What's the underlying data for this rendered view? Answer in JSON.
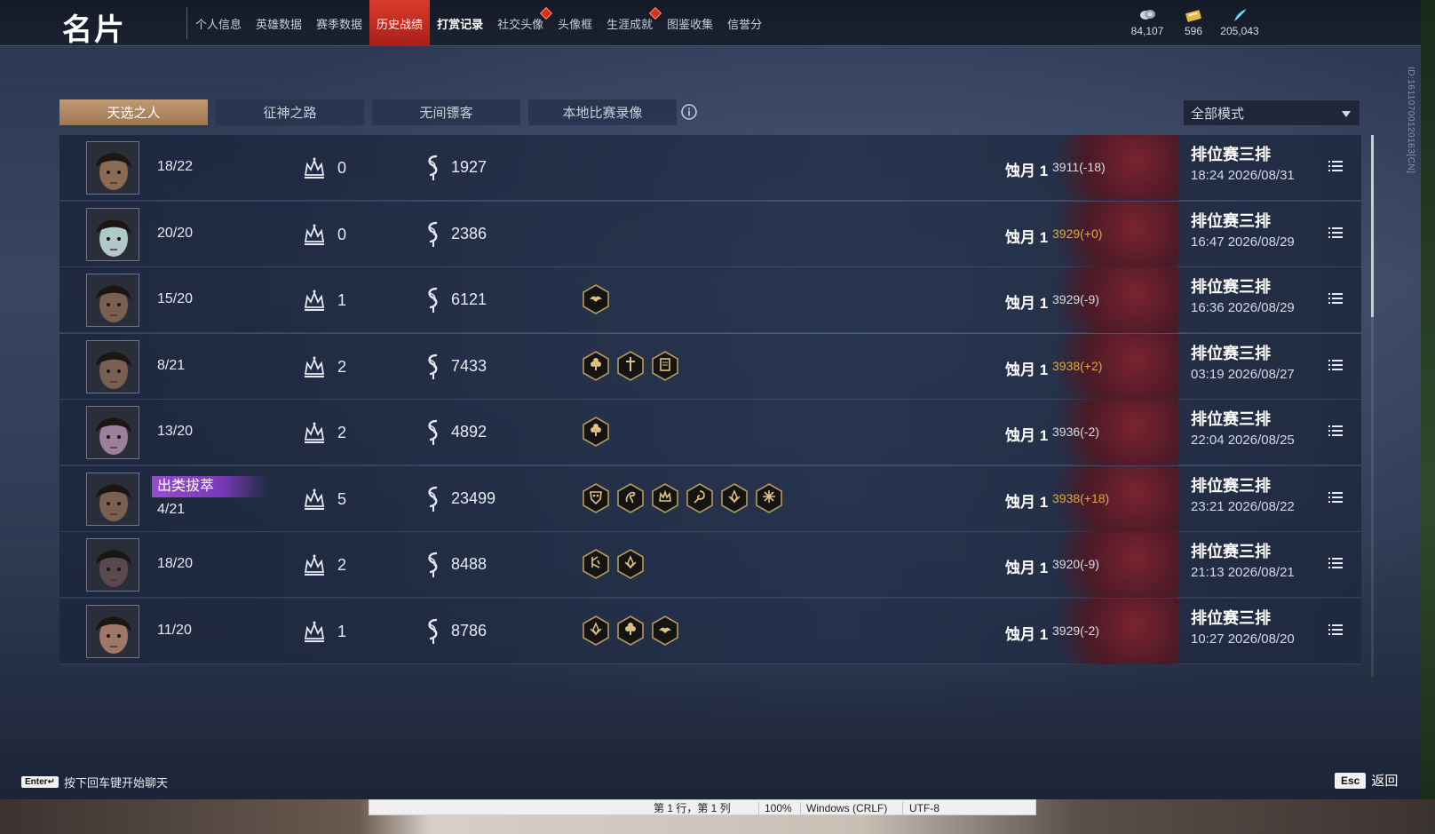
{
  "header": {
    "title": "名片",
    "nav": [
      {
        "label": "个人信息",
        "active": false,
        "badge": false
      },
      {
        "label": "英雄数据",
        "active": false,
        "badge": false
      },
      {
        "label": "赛季数据",
        "active": false,
        "badge": false
      },
      {
        "label": "历史战绩",
        "active": true,
        "badge": false
      },
      {
        "label": "打赏记录",
        "active": false,
        "badge": false
      },
      {
        "label": "社交头像",
        "active": false,
        "badge": true
      },
      {
        "label": "头像框",
        "active": false,
        "badge": false
      },
      {
        "label": "生涯成就",
        "active": false,
        "badge": true
      },
      {
        "label": "图鉴收集",
        "active": false,
        "badge": false
      },
      {
        "label": "信誉分",
        "active": false,
        "badge": false
      }
    ],
    "currencies": [
      {
        "icon": "coin-icon",
        "value": "84,107"
      },
      {
        "icon": "ticket-icon",
        "value": "596"
      },
      {
        "icon": "gem-icon",
        "value": "205,043"
      }
    ]
  },
  "side_id": "ID:161107001201​63[CN]",
  "mode_tabs": [
    {
      "label": "天选之人",
      "active": true
    },
    {
      "label": "征神之路",
      "active": false
    },
    {
      "label": "无间镖客",
      "active": false
    },
    {
      "label": "本地比赛录像",
      "active": false
    }
  ],
  "filter": {
    "selected": "全部模式"
  },
  "matches": [
    {
      "kda": "18/22",
      "honor": "",
      "kills": "0",
      "damage": "1927",
      "badges": [],
      "rank": "蚀月 1",
      "score": "3911(-18)",
      "score_gold": false,
      "mode": "排位赛三排",
      "time": "18:24  2026/08/31",
      "skin": "#8a6a50"
    },
    {
      "kda": "20/20",
      "honor": "",
      "kills": "0",
      "damage": "2386",
      "badges": [],
      "rank": "蚀月 1",
      "score": "3929(+0)",
      "score_gold": true,
      "mode": "排位赛三排",
      "time": "16:47  2026/08/29",
      "skin": "#b0c8c8"
    },
    {
      "kda": "15/20",
      "honor": "",
      "kills": "1",
      "damage": "6121",
      "badges": [
        "wings-badge"
      ],
      "rank": "蚀月 1",
      "score": "3929(-9)",
      "score_gold": false,
      "mode": "排位赛三排",
      "time": "16:36  2026/08/29",
      "skin": "#7a6050"
    },
    {
      "kda": "8/21",
      "honor": "",
      "kills": "2",
      "damage": "7433",
      "badges": [
        "clover-badge",
        "sword-badge",
        "scroll-badge"
      ],
      "rank": "蚀月 1",
      "score": "3938(+2)",
      "score_gold": true,
      "mode": "排位赛三排",
      "time": "03:19  2026/08/27",
      "skin": "#7a6050"
    },
    {
      "kda": "13/20",
      "honor": "",
      "kills": "2",
      "damage": "4892",
      "badges": [
        "clover-badge"
      ],
      "rank": "蚀月 1",
      "score": "3936(-2)",
      "score_gold": false,
      "mode": "排位赛三排",
      "time": "22:04  2026/08/25",
      "skin": "#9a8098"
    },
    {
      "kda": "4/21",
      "honor": "出类拔萃",
      "kills": "5",
      "damage": "23499",
      "badges": [
        "mask-badge",
        "dragon-badge",
        "crown-badge",
        "swirl-badge",
        "lotus-badge",
        "star-badge"
      ],
      "rank": "蚀月 1",
      "score": "3938(+18)",
      "score_gold": true,
      "mode": "排位赛三排",
      "time": "23:21  2026/08/22",
      "skin": "#7a6050"
    },
    {
      "kda": "18/20",
      "honor": "",
      "kills": "2",
      "damage": "8488",
      "badges": [
        "rune-badge",
        "lotus-badge"
      ],
      "rank": "蚀月 1",
      "score": "3920(-9)",
      "score_gold": false,
      "mode": "排位赛三排",
      "time": "21:13  2026/08/21",
      "skin": "#5a4a50"
    },
    {
      "kda": "11/20",
      "honor": "",
      "kills": "1",
      "damage": "8786",
      "badges": [
        "lotus-badge",
        "clover-badge",
        "wings-badge"
      ],
      "rank": "蚀月 1",
      "score": "3929(-2)",
      "score_gold": false,
      "mode": "排位赛三排",
      "time": "10:27  2026/08/20",
      "skin": "#a07868"
    }
  ],
  "footer": {
    "enter_key": "Enter↵",
    "enter_hint": "按下回车键开始聊天",
    "esc_key": "Esc",
    "esc_label": "返回"
  },
  "statusbar": {
    "position": "第 1 行，第 1 列",
    "zoom": "100%",
    "line_ending": "Windows (CRLF)",
    "encoding": "UTF-8"
  }
}
